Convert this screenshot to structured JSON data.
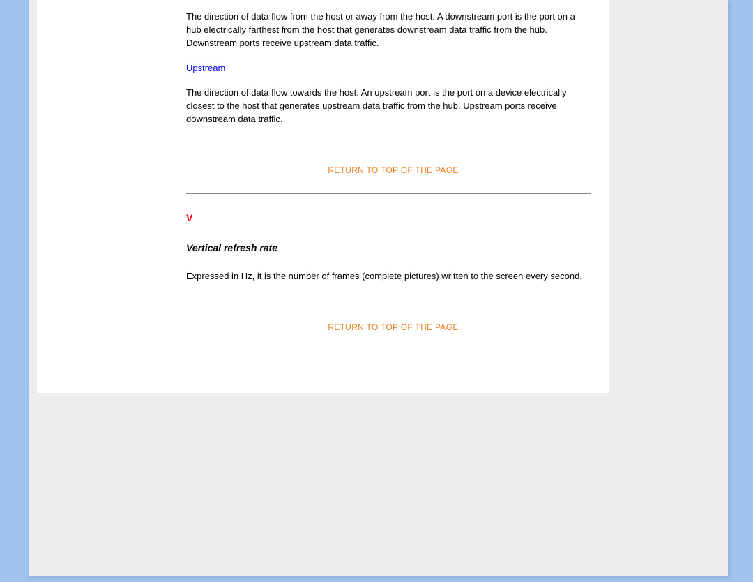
{
  "content": {
    "downstream_def": "The direction of data flow from the host or away from the host. A downstream port is the port on a hub electrically farthest from the host that generates downstream data traffic from the hub. Downstream ports receive upstream data traffic.",
    "upstream_term": "Upstream",
    "upstream_def": "The direction of data flow towards the host. An upstream port is the port on a device electrically closest to the host that generates upstream data traffic from the hub. Upstream ports receive downstream data traffic.",
    "return_link_1": "RETURN TO TOP OF THE PAGE",
    "section_v": "V",
    "vrr_heading": "Vertical refresh rate",
    "vrr_def": "Expressed in Hz, it is the number of frames (complete pictures) written to the screen every second.",
    "return_link_2": "RETURN TO TOP OF THE PAGE"
  }
}
